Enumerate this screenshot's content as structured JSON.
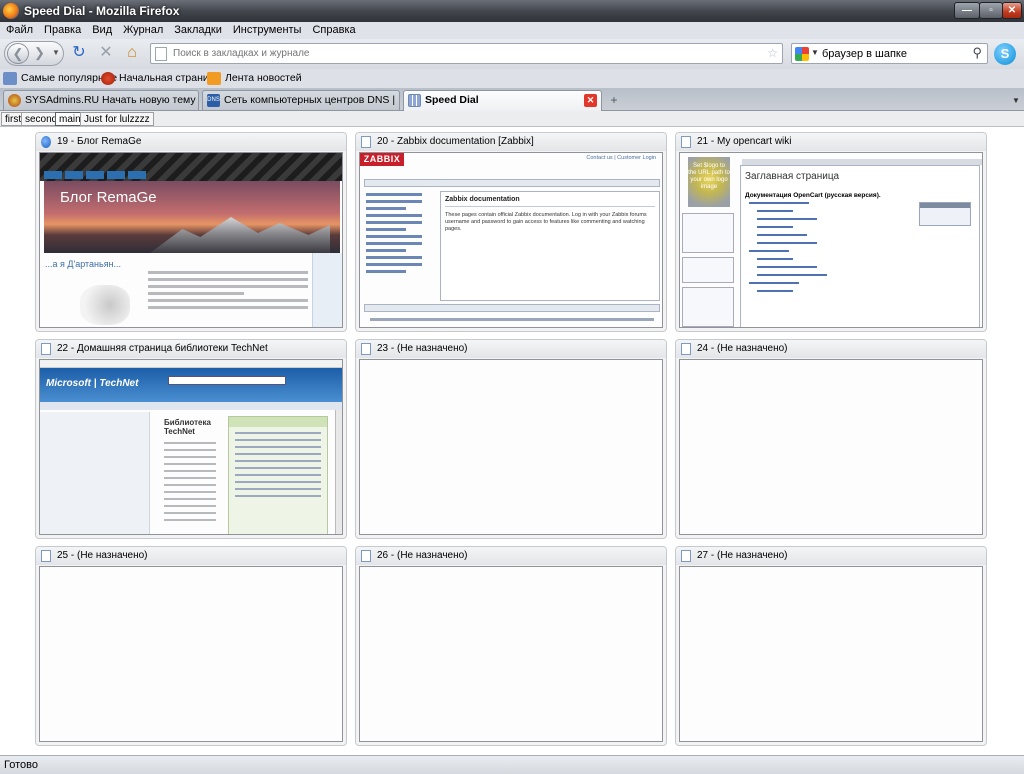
{
  "window": {
    "title": "Speed Dial - Mozilla Firefox"
  },
  "menu": [
    "Файл",
    "Правка",
    "Вид",
    "Журнал",
    "Закладки",
    "Инструменты",
    "Справка"
  ],
  "nav": {
    "url_placeholder": "Поиск в закладках и журнале",
    "search_value": "браузер в шапке",
    "search_engine_icon": "google-icon"
  },
  "bookmarks": [
    {
      "label": "Самые популярные",
      "icon": "clock-icon"
    },
    {
      "label": "Начальная страница",
      "icon": "firefox-icon"
    },
    {
      "label": "Лента новостей",
      "icon": "rss-icon"
    }
  ],
  "tabs": [
    {
      "label": "SYSAdmins.RU Начать новую тему",
      "active": false
    },
    {
      "label": "Сеть компьютерных центров DNS | ...",
      "active": false
    },
    {
      "label": "Speed Dial",
      "active": true
    }
  ],
  "groups": [
    "first",
    "second",
    "main",
    "Just for lulzzzz"
  ],
  "dials": [
    {
      "title": "19 - Блог RemaGe",
      "thumb": "remage"
    },
    {
      "title": "20 - Zabbix documentation [Zabbix]",
      "thumb": "zabbix"
    },
    {
      "title": "21 - My opencart wiki",
      "thumb": "opencart"
    },
    {
      "title": "22 - Домашняя страница библиотеки TechNet",
      "thumb": "technet"
    },
    {
      "title": "23 - (Не назначено)",
      "thumb": ""
    },
    {
      "title": "24 - (Не назначено)",
      "thumb": ""
    },
    {
      "title": "25 - (Не назначено)",
      "thumb": ""
    },
    {
      "title": "26 - (Не назначено)",
      "thumb": ""
    },
    {
      "title": "27 - (Не назначено)",
      "thumb": ""
    }
  ],
  "thumbs": {
    "remage": {
      "title": "Блог RemaGe",
      "subtitle": "...а я Д'артаньян..."
    },
    "zabbix": {
      "logo": "ZABBIX",
      "top_links": "Contact us | Customer Login",
      "heading": "Zabbix documentation",
      "text": "These pages contain official Zabbix documentation. Log in with your Zabbix forums username and password to gain access to features like commenting and watching pages."
    },
    "opencart": {
      "logo_text": "Set $logo to the URL path to your own logo image",
      "heading": "Заглавная страница",
      "subheading": "Документация OpenCart (русская версия)."
    },
    "technet": {
      "brand": "Microsoft | TechNet",
      "heading": "Библиотека TechNet"
    }
  },
  "status": "Готово"
}
